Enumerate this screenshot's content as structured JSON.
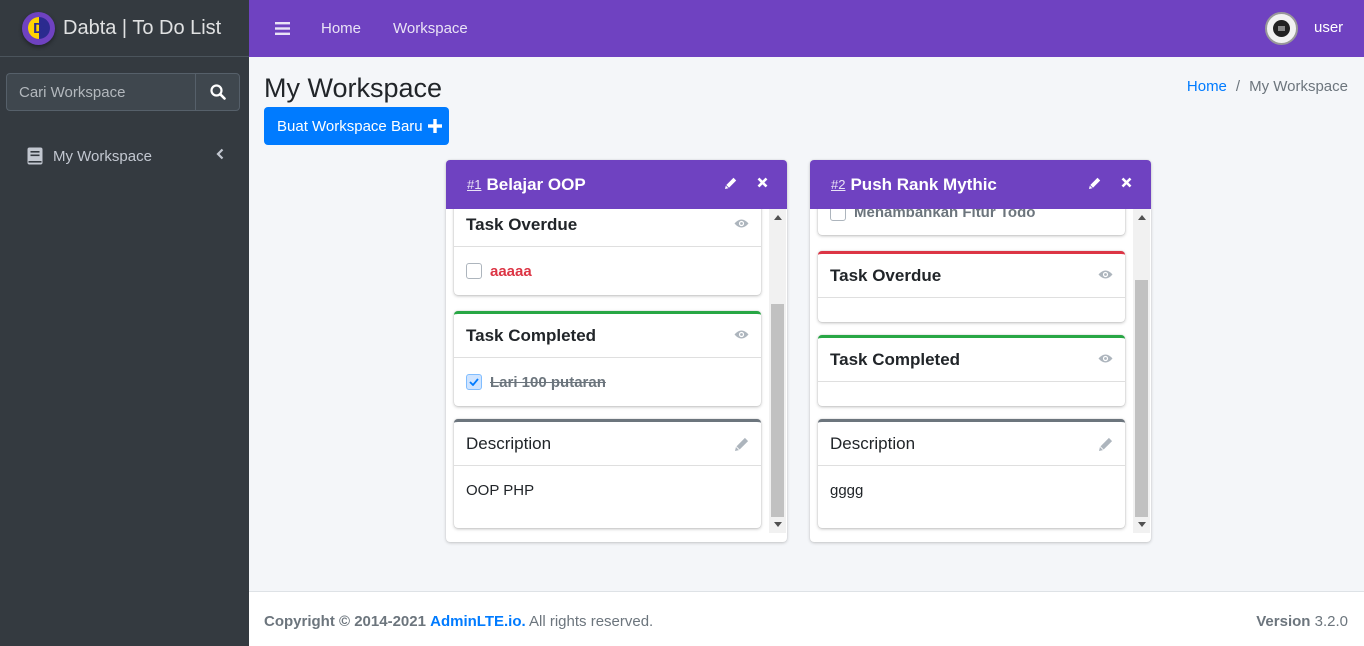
{
  "brand": {
    "title": "Dabta | To Do List",
    "logo_letter": "D"
  },
  "sidebar": {
    "search_placeholder": "Cari Workspace",
    "items": [
      {
        "label": "My Workspace",
        "icon": "book-icon"
      }
    ]
  },
  "topbar": {
    "nav": [
      {
        "label": "Home"
      },
      {
        "label": "Workspace"
      }
    ],
    "user": "user"
  },
  "header": {
    "title": "My Workspace",
    "breadcrumb": [
      "Home",
      "My Workspace"
    ],
    "breadcrumb_sep": "/",
    "new_button": "Buat Workspace Baru"
  },
  "workspaces": [
    {
      "number": "#1",
      "title": "Belajar OOP",
      "overdue": {
        "title": "Task Overdue",
        "task": "aaaaa"
      },
      "completed": {
        "title": "Task Completed",
        "task": "Lari 100 putaran"
      },
      "description": {
        "title": "Description",
        "text": "OOP PHP"
      }
    },
    {
      "number": "#2",
      "title": "Push Rank Mythic",
      "partial_task": "Menambahkan Fitur Todo",
      "overdue": {
        "title": "Task Overdue"
      },
      "completed": {
        "title": "Task Completed"
      },
      "description": {
        "title": "Description",
        "text": "gggg"
      }
    }
  ],
  "footer": {
    "copyright": "Copyright © 2014-2021",
    "link": "AdminLTE.io.",
    "rights": "All rights reserved.",
    "version_label": "Version",
    "version": "3.2.0"
  },
  "colors": {
    "primary": "#6f42c1",
    "sidebar": "#343a40",
    "link": "#007bff",
    "danger": "#dc3545",
    "success": "#28a745"
  }
}
